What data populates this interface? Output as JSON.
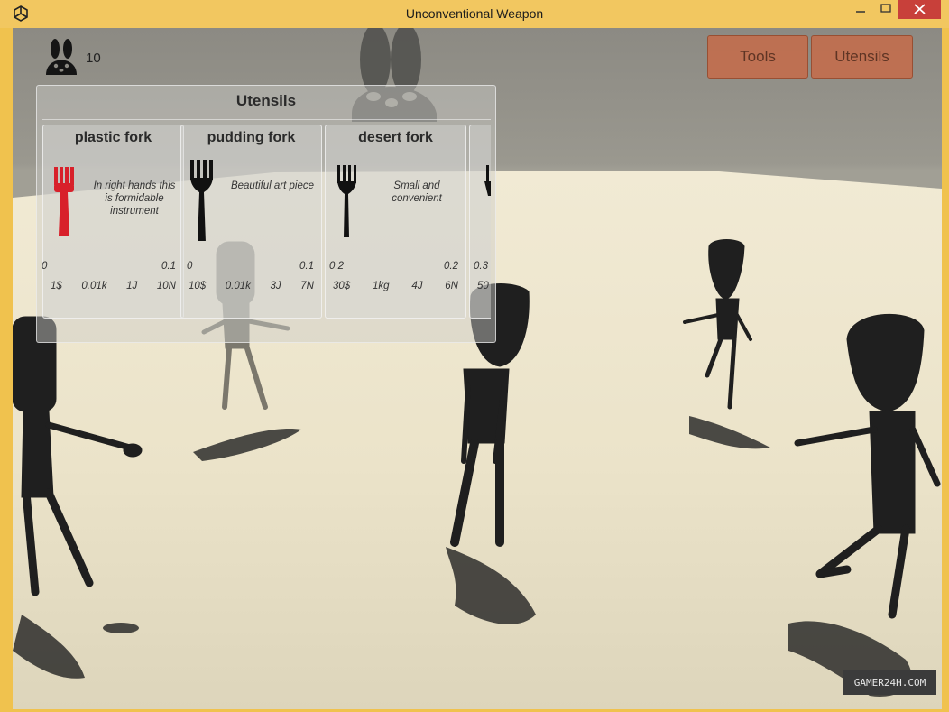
{
  "window": {
    "title": "Unconventional Weapon"
  },
  "hud": {
    "coins": "10",
    "coin_icon": "bunny-icon"
  },
  "menu": {
    "tools_label": "Tools",
    "utensils_label": "Utensils"
  },
  "panel": {
    "title": "Utensils",
    "items": [
      {
        "name": "plastic fork",
        "description": "In right hands this is formidable instrument",
        "range_min": "0",
        "range_max": "0.1",
        "price": "1$",
        "weight": "0.01k",
        "energy": "1J",
        "force": "10N",
        "color": "#d8202a"
      },
      {
        "name": "pudding fork",
        "description": "Beautiful art piece",
        "range_min": "0",
        "range_max": "0.1",
        "price": "10$",
        "weight": "0.01k",
        "energy": "3J",
        "force": "7N",
        "color": "#111111"
      },
      {
        "name": "desert fork",
        "description": "Small and convenient",
        "range_min": "0.2",
        "range_max": "0.2",
        "price": "30$",
        "weight": "1kg",
        "energy": "4J",
        "force": "6N",
        "color": "#111111"
      },
      {
        "name": "",
        "description": "",
        "range_min": "0.3",
        "range_max": "",
        "price": "50",
        "weight": "",
        "energy": "",
        "force": "",
        "color": "#111111"
      }
    ]
  },
  "watermark": "GAMER24H.COM",
  "colors": {
    "titlebar": "#f2c760",
    "button": "#c26e4e",
    "close": "#c8403a",
    "floor": "#efe7cf"
  }
}
